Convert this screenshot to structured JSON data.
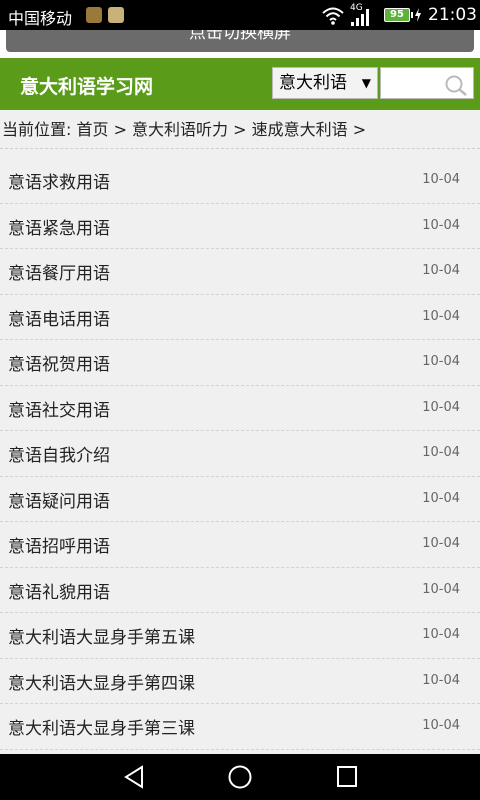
{
  "status": {
    "carrier": "中国移动",
    "network": "4G",
    "battery": "95",
    "time": "21:03"
  },
  "rotate_label": "点击切换横屏",
  "header": {
    "logo": "意大利语学习网",
    "select_value": "意大利语",
    "select_arrow": "▼",
    "search_placeholder": ""
  },
  "breadcrumb": "当前位置: 首页 > 意大利语听力 > 速成意大利语 >",
  "list": [
    {
      "title": "意语求救用语",
      "date": "10-04"
    },
    {
      "title": "意语紧急用语",
      "date": "10-04"
    },
    {
      "title": "意语餐厅用语",
      "date": "10-04"
    },
    {
      "title": "意语电话用语",
      "date": "10-04"
    },
    {
      "title": "意语祝贺用语",
      "date": "10-04"
    },
    {
      "title": "意语社交用语",
      "date": "10-04"
    },
    {
      "title": "意语自我介绍",
      "date": "10-04"
    },
    {
      "title": "意语疑问用语",
      "date": "10-04"
    },
    {
      "title": "意语招呼用语",
      "date": "10-04"
    },
    {
      "title": "意语礼貌用语",
      "date": "10-04"
    },
    {
      "title": "意大利语大显身手第五课",
      "date": "10-04"
    },
    {
      "title": "意大利语大显身手第四课",
      "date": "10-04"
    },
    {
      "title": "意大利语大显身手第三课",
      "date": "10-04"
    }
  ],
  "colors": {
    "header_green": "#5a9c1a",
    "battery_green": "#5db33a"
  }
}
